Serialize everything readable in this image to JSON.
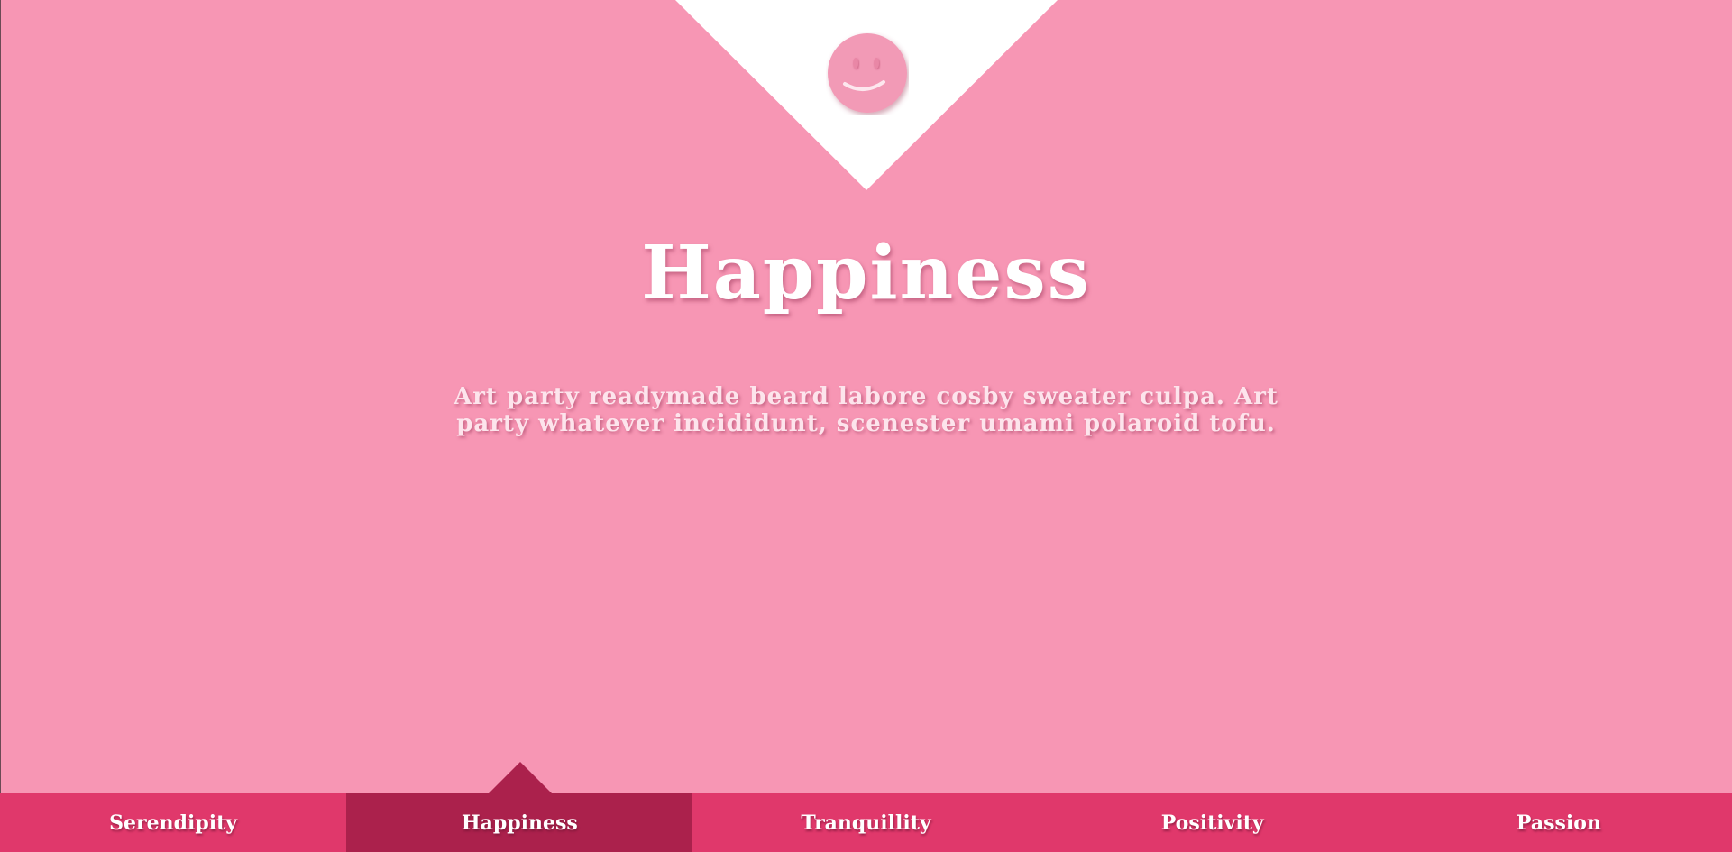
{
  "hero": {
    "icon": "smiley-face-icon",
    "title": "Happiness",
    "description": "Art party readymade beard labore cosby sweater culpa. Art party whatever incididunt, scenester umami polaroid tofu."
  },
  "nav": {
    "items": [
      {
        "label": "Serendipity",
        "active": false
      },
      {
        "label": "Happiness",
        "active": true
      },
      {
        "label": "Tranquillity",
        "active": false
      },
      {
        "label": "Positivity",
        "active": false
      },
      {
        "label": "Passion",
        "active": false
      }
    ]
  },
  "colors": {
    "background": "#f796b4",
    "nav_background": "#e0386b",
    "nav_active": "#ab214c",
    "accent_white": "#ffffff"
  }
}
